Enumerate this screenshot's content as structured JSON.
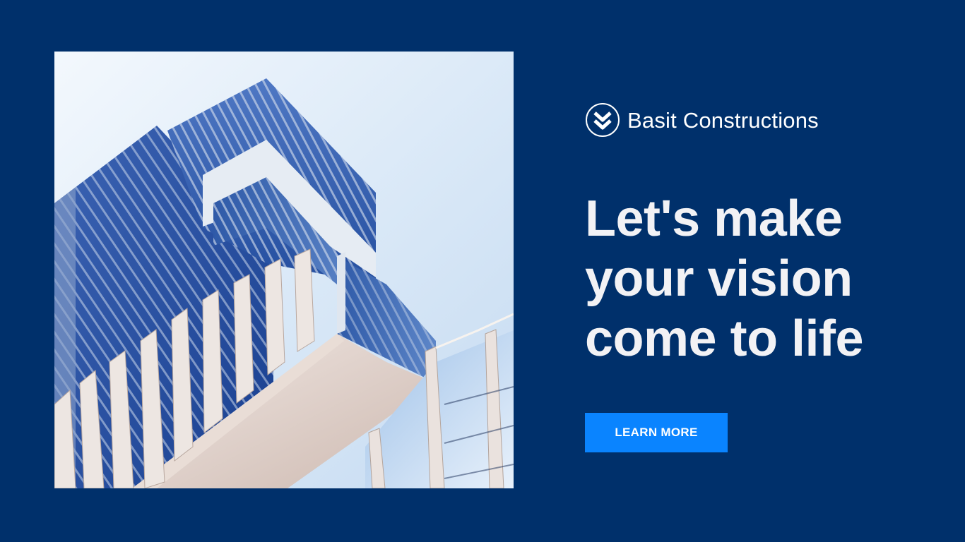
{
  "brand": {
    "name": "Basit Constructions",
    "logo_icon": "double-chevron-down-icon"
  },
  "headline": {
    "lines": [
      "Let's make",
      "your vision",
      "come to life"
    ]
  },
  "cta": {
    "label": "LEARN MORE"
  },
  "hero_image": {
    "icon": "skyscraper-photo"
  },
  "colors": {
    "background": "#00306b",
    "button": "#0a84ff",
    "headline": "#f2f2f5",
    "brand_text": "#ffffff"
  }
}
